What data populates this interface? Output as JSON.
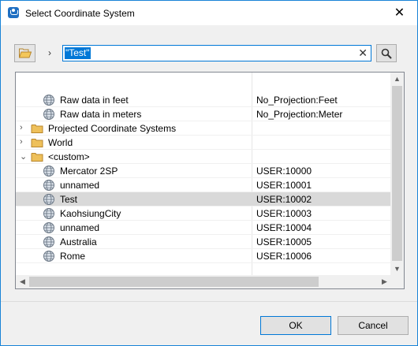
{
  "window": {
    "title": "Select Coordinate System",
    "close_glyph": "✕"
  },
  "toolbar": {
    "breadcrumb_arrow": "›",
    "search_value": "\"Test\"",
    "clear_glyph": "✕"
  },
  "tree": {
    "rows": [
      {
        "type": "leaf",
        "indent": 1,
        "name": "Raw data in feet",
        "code": "No_Projection:Feet",
        "icon": "globe-icon"
      },
      {
        "type": "leaf",
        "indent": 1,
        "name": "Raw data in meters",
        "code": "No_Projection:Meter",
        "icon": "globe-icon"
      },
      {
        "type": "folder",
        "indent": 0,
        "expanded": false,
        "name": "Projected Coordinate Systems",
        "code": "",
        "icon": "folder-icon"
      },
      {
        "type": "folder",
        "indent": 0,
        "expanded": false,
        "name": "World",
        "code": "",
        "icon": "folder-icon"
      },
      {
        "type": "folder",
        "indent": 0,
        "expanded": true,
        "name": "<custom>",
        "code": "",
        "icon": "folder-icon"
      },
      {
        "type": "leaf",
        "indent": 1,
        "name": "Mercator 2SP",
        "code": "USER:10000",
        "icon": "globe-icon"
      },
      {
        "type": "leaf",
        "indent": 1,
        "name": "unnamed",
        "code": "USER:10001",
        "icon": "globe-icon"
      },
      {
        "type": "leaf",
        "indent": 1,
        "name": "Test",
        "code": "USER:10002",
        "icon": "globe-icon",
        "selected": true
      },
      {
        "type": "leaf",
        "indent": 1,
        "name": "KaohsiungCity",
        "code": "USER:10003",
        "icon": "globe-icon"
      },
      {
        "type": "leaf",
        "indent": 1,
        "name": "unnamed",
        "code": "USER:10004",
        "icon": "globe-icon"
      },
      {
        "type": "leaf",
        "indent": 1,
        "name": "Australia",
        "code": "USER:10005",
        "icon": "globe-icon"
      },
      {
        "type": "leaf",
        "indent": 1,
        "name": "Rome",
        "code": "USER:10006",
        "icon": "globe-icon"
      }
    ]
  },
  "buttons": {
    "ok": "OK",
    "cancel": "Cancel"
  },
  "colors": {
    "accent": "#0078d7",
    "selection": "#d9d9d9",
    "folder": "#e8b84a"
  }
}
